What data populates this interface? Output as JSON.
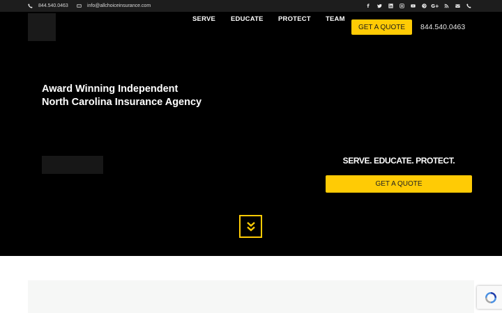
{
  "topbar": {
    "phone": "844.540.0463",
    "email": "info@allchoiceinsurance.com",
    "social_icons": [
      "facebook-icon",
      "twitter-icon",
      "linkedin-icon",
      "instagram-icon",
      "youtube-icon",
      "pinterest-icon",
      "google-plus-icon",
      "rss-icon",
      "envelope-icon",
      "phone-icon"
    ]
  },
  "nav": {
    "items": [
      "SERVE",
      "EDUCATE",
      "PROTECT",
      "TEAM"
    ],
    "quote_label": "GET A QUOTE",
    "phone": "844.540.0463"
  },
  "hero": {
    "headline_line1": "Award Winning Independent",
    "headline_line2": "North Carolina Insurance Agency",
    "tagline": "SERVE. EDUCATE. PROTECT.",
    "quote_label": "GET A QUOTE"
  },
  "colors": {
    "accent": "#ffcb05",
    "hero_bg": "#000000",
    "topbar_bg": "#1d1d1d"
  }
}
